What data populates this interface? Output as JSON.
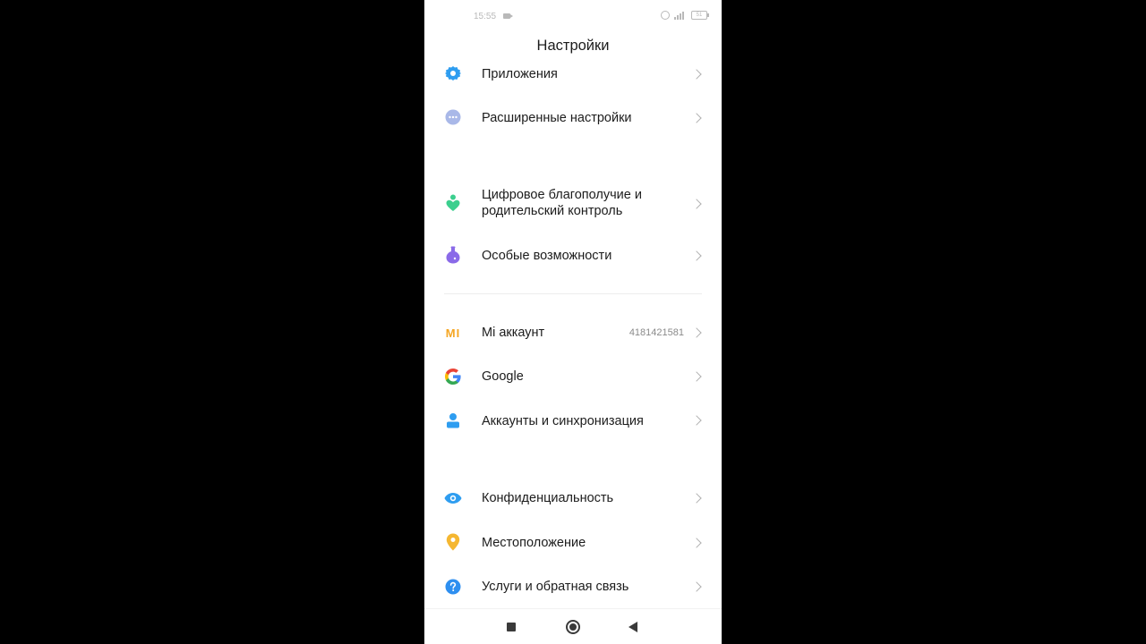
{
  "status_bar": {
    "time": "15:55",
    "battery": "51"
  },
  "header": {
    "title": "Настройки"
  },
  "items": [
    {
      "label": "Приложения",
      "icon": "gear-icon",
      "color": "#2e9df0"
    },
    {
      "label": "Расширенные настройки",
      "icon": "more-dots-icon",
      "color": "#a9b8e8"
    },
    {
      "label": "Цифровое благополучие и родительский контроль",
      "icon": "wellbeing-heart-icon",
      "color": "#3ccf8e"
    },
    {
      "label": "Особые возможности",
      "icon": "accessibility-flask-icon",
      "color": "#8a6ae8"
    },
    {
      "label": "Mi аккаунт",
      "icon": "mi-logo-icon",
      "color": "#f5a623",
      "value": "4181421581"
    },
    {
      "label": "Google",
      "icon": "google-g-icon",
      "color": "#4285f4"
    },
    {
      "label": "Аккаунты и синхронизация",
      "icon": "person-icon",
      "color": "#2e9df0"
    },
    {
      "label": "Конфиденциальность",
      "icon": "eye-icon",
      "color": "#2e9df0"
    },
    {
      "label": "Местоположение",
      "icon": "location-pin-icon",
      "color": "#f5b731"
    },
    {
      "label": "Услуги и обратная связь",
      "icon": "help-question-icon",
      "color": "#2e8ff0"
    }
  ],
  "icon_mi_text": "MI"
}
